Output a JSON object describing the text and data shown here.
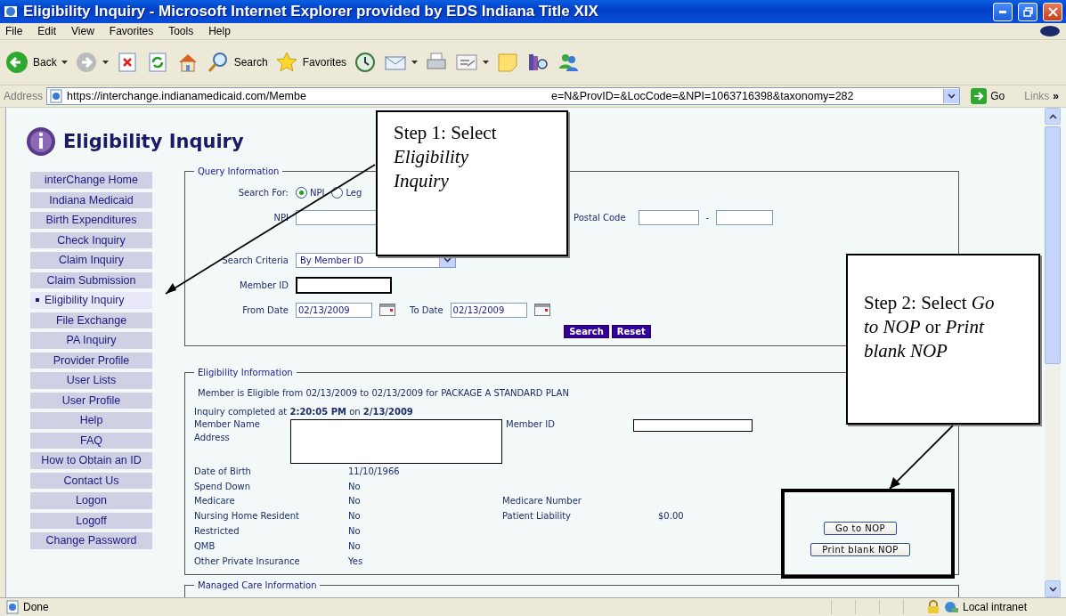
{
  "window": {
    "title": "Eligibility Inquiry - Microsoft Internet Explorer provided by EDS Indiana Title XIX"
  },
  "menu": [
    "File",
    "Edit",
    "View",
    "Favorites",
    "Tools",
    "Help"
  ],
  "toolbar": [
    {
      "kind": "back",
      "label": "Back",
      "has_menu": true
    },
    {
      "kind": "forward",
      "has_menu": true
    },
    {
      "kind": "stop",
      "has_menu": false
    },
    {
      "kind": "refresh",
      "has_menu": false
    },
    {
      "kind": "home",
      "has_menu": false
    },
    {
      "kind": "search",
      "label": "Search",
      "has_menu": false
    },
    {
      "kind": "favorites",
      "label": "Favorites",
      "has_menu": false
    },
    {
      "kind": "history",
      "has_menu": false
    },
    {
      "kind": "mail",
      "has_menu": true
    },
    {
      "kind": "print",
      "has_menu": false
    },
    {
      "kind": "edit",
      "has_menu": true
    },
    {
      "kind": "notes",
      "has_menu": false
    },
    {
      "kind": "research",
      "has_menu": false
    },
    {
      "kind": "messenger",
      "has_menu": false
    }
  ],
  "address": {
    "label": "Address",
    "url_parts": [
      "https://interchange.indianamedicaid.com/Membe",
      "e=N&ProvID=&LocCode=&NPI=1063716398&taxonomy=282"
    ],
    "go": "Go",
    "links": "Links",
    "links_more": "»"
  },
  "page": {
    "title": "Eligibility Inquiry"
  },
  "sidebar": {
    "items": [
      {
        "label": "interChange Home",
        "selected": false
      },
      {
        "label": "Indiana Medicaid",
        "selected": false
      },
      {
        "label": "Birth Expenditures",
        "selected": false
      },
      {
        "label": "Check Inquiry",
        "selected": false
      },
      {
        "label": "Claim Inquiry",
        "selected": false
      },
      {
        "label": "Claim Submission",
        "selected": false
      },
      {
        "label": "Eligibility Inquiry",
        "selected": true
      },
      {
        "label": "File Exchange",
        "selected": false
      },
      {
        "label": "PA Inquiry",
        "selected": false
      },
      {
        "label": "Provider Profile",
        "selected": false
      },
      {
        "label": "User Lists",
        "selected": false
      },
      {
        "label": "User Profile",
        "selected": false
      },
      {
        "label": "Help",
        "selected": false
      },
      {
        "label": "FAQ",
        "selected": false
      },
      {
        "label": "How to Obtain an ID",
        "selected": false
      },
      {
        "label": "Contact Us",
        "selected": false
      },
      {
        "label": "Logon",
        "selected": false
      },
      {
        "label": "Logoff",
        "selected": false
      },
      {
        "label": "Change Password",
        "selected": false
      }
    ]
  },
  "query": {
    "legend": "Query Information",
    "search_for_label": "Search For:",
    "search_for_options": [
      {
        "label": "NPI",
        "selected": true
      },
      {
        "label": "Leg",
        "selected": false
      }
    ],
    "npi_label": "NPI",
    "postal_label": "Postal Code",
    "postal_separator": "-",
    "criteria_label": "Search Criteria",
    "criteria_value": "By Member ID",
    "member_id_label": "Member ID",
    "from_label": "From Date",
    "from_value": "02/13/2009",
    "to_label": "To Date",
    "to_value": "02/13/2009",
    "buttons": [
      "Search",
      "Reset"
    ]
  },
  "eligibility": {
    "legend": "Eligibility Information",
    "summary": "Member is Eligible from 02/13/2009 to 02/13/2009 for PACKAGE A STANDARD PLAN",
    "completed": "Inquiry completed at **2:20:05 PM** on **2/13/2009**",
    "member_name_label": "Member Name",
    "address_label": "Address",
    "member_id_label": "Member ID",
    "rows": [
      {
        "label": "Date of Birth",
        "value": "11/10/1966"
      },
      {
        "label": "Spend Down",
        "value": "No"
      },
      {
        "label": "Medicare",
        "value": "No",
        "label2": "Medicare Number"
      },
      {
        "label": "Nursing Home Resident",
        "value": "No",
        "label2": "Patient Liability",
        "value2": "$0.00"
      },
      {
        "label": "Restricted",
        "value": "No"
      },
      {
        "label": "QMB",
        "value": "No"
      },
      {
        "label": "Other Private Insurance",
        "value": "Yes"
      }
    ],
    "nop_buttons": [
      "Go to NOP",
      "Print blank NOP"
    ]
  },
  "managed_care": {
    "legend": "Managed Care Information"
  },
  "status": {
    "text": "Done",
    "zone": "Local intranet"
  },
  "callouts": [
    {
      "text": "Step 1: Select *Eligibility Inquiry*"
    },
    {
      "text": "Step 2: Select *Go to NOP* or *Print blank NOP*"
    }
  ]
}
